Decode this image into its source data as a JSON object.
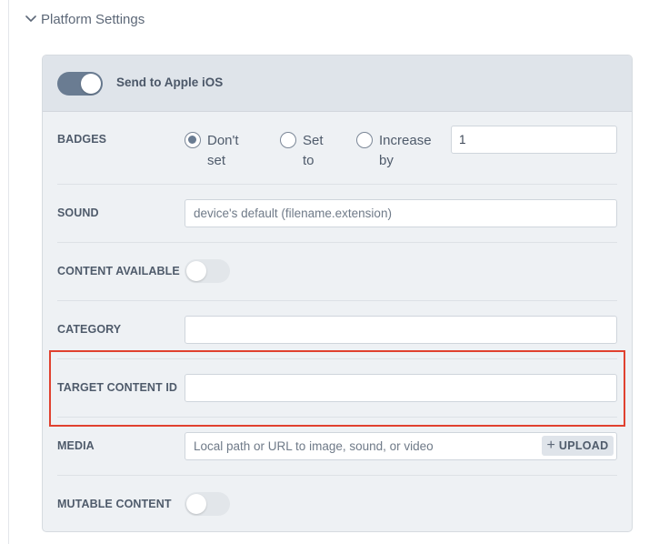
{
  "section": {
    "title": "Platform Settings",
    "icon": "chevron-down-icon"
  },
  "panel": {
    "header": {
      "label": "Send to Apple iOS",
      "toggle_on": true
    },
    "badges": {
      "label": "BADGES",
      "options": [
        {
          "line1": "Don't",
          "line2": "set",
          "checked": true
        },
        {
          "line1": "Set",
          "line2": "to",
          "checked": false
        },
        {
          "line1": "Increase",
          "line2": "by",
          "checked": false
        }
      ],
      "value": "1"
    },
    "sound": {
      "label": "SOUND",
      "placeholder": "device's default (filename.extension)"
    },
    "content_available": {
      "label": "CONTENT AVAILABLE",
      "toggle_on": false
    },
    "category": {
      "label": "CATEGORY",
      "value": ""
    },
    "target_content_id": {
      "label": "TARGET CONTENT ID",
      "value": ""
    },
    "media": {
      "label": "MEDIA",
      "placeholder": "Local path or URL to image, sound, or video",
      "upload_label": "UPLOAD"
    },
    "mutable_content": {
      "label": "MUTABLE CONTENT",
      "toggle_on": false
    }
  },
  "colors": {
    "highlight": "#e0412f",
    "toggle_on": "#6a7c92",
    "panel_bg": "#eef1f4"
  }
}
